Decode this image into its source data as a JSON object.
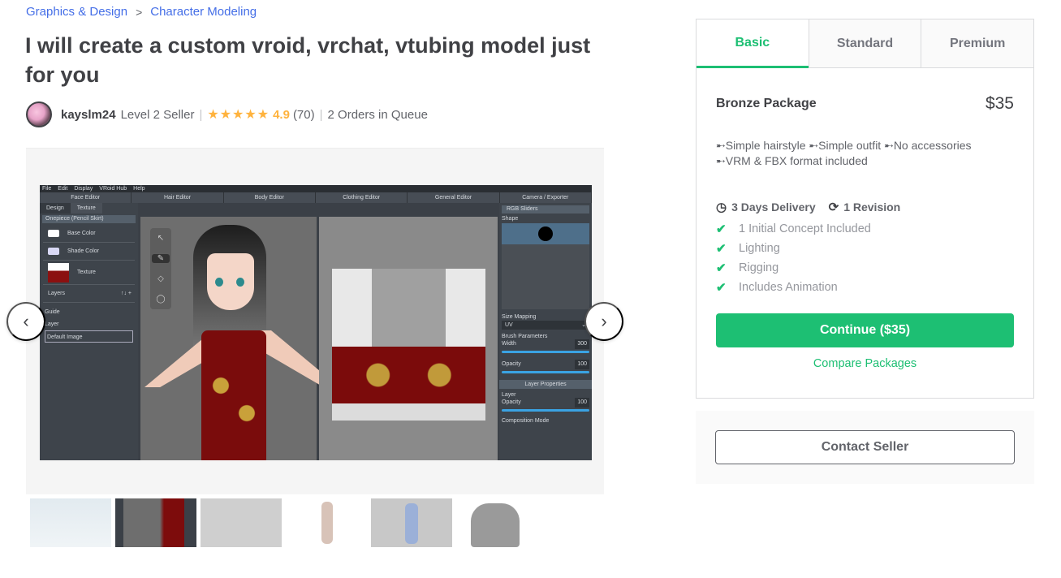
{
  "breadcrumb": {
    "items": [
      "Graphics & Design",
      "Character Modeling"
    ],
    "separator": ">"
  },
  "gig": {
    "title": "I will create a custom vroid, vrchat, vtubing model just for you"
  },
  "seller": {
    "username": "kayslm24",
    "level": "Level 2 Seller",
    "stars": "★★★★★",
    "rating": "4.9",
    "review_count": "(70)",
    "queue": "2 Orders in Queue"
  },
  "gallery": {
    "prev_icon": "‹",
    "next_icon": "›",
    "screenshot": {
      "menu": [
        "File",
        "Edit",
        "Display",
        "VRoid Hub",
        "Help"
      ],
      "editors": [
        "Face Editor",
        "Hair Editor",
        "Body Editor",
        "Clothing Editor",
        "General Editor",
        "Camera / Exporter"
      ],
      "left_tabs": [
        "Design",
        "Texture"
      ],
      "section": "Onepiece (Pencil Skirt)",
      "props": [
        "Base Color",
        "Shade Color",
        "Texture"
      ],
      "layers_label": "Layers",
      "layers_controls": "↑↓ +",
      "layers": [
        "Guide",
        "Layer",
        "Default Image"
      ],
      "rgb_sliders": "RGB Sliders",
      "shape_label": "Shape",
      "size_mapping_label": "Size Mapping",
      "size_mapping_value": "UV",
      "brush_params": "Brush Parameters",
      "width_label": "Width",
      "width_value": "300",
      "opacity_label": "Opacity",
      "opacity_value": "100",
      "layer_properties": "Layer Properties",
      "layer_label": "Layer",
      "layer_opacity_label": "Opacity",
      "layer_opacity_value": "100",
      "composition_mode": "Composition Mode"
    },
    "thumbnail_count": 6,
    "active_thumbnail": 2
  },
  "packages": {
    "tabs": [
      "Basic",
      "Standard",
      "Premium"
    ],
    "active_tab": "Basic",
    "name": "Bronze Package",
    "price": "$35",
    "description": "➸Simple hairstyle ➸Simple outfit ➸No accessories ➸VRM & FBX format included",
    "delivery": "3 Days Delivery",
    "revisions": "1 Revision",
    "features": [
      "1 Initial Concept Included",
      "Lighting",
      "Rigging",
      "Includes Animation"
    ],
    "continue_label": "Continue ($35)",
    "compare_label": "Compare Packages",
    "accent_color": "#1dbf73"
  },
  "contact": {
    "label": "Contact Seller"
  }
}
